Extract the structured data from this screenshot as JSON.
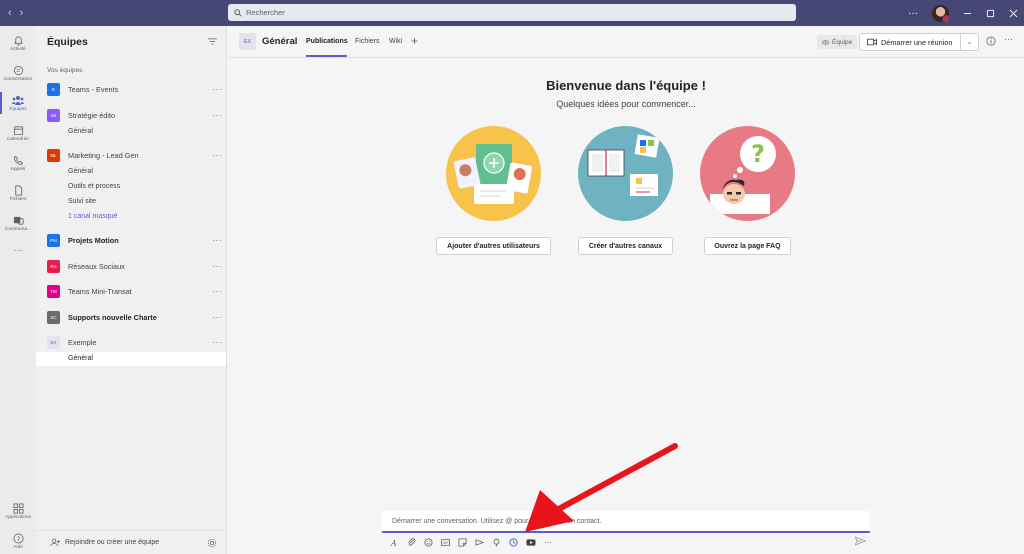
{
  "titlebar": {
    "search_placeholder": "Rechercher",
    "more": "···",
    "back_arrow": "‹",
    "forward_arrow": "›"
  },
  "rail": {
    "items": [
      {
        "label": "Activité",
        "icon": "bell-icon"
      },
      {
        "label": "Conversation",
        "icon": "chat-icon"
      },
      {
        "label": "Équipes",
        "icon": "teams-icon",
        "active": true
      },
      {
        "label": "Calendrier",
        "icon": "calendar-icon"
      },
      {
        "label": "Appels",
        "icon": "phone-icon"
      },
      {
        "label": "Fichiers",
        "icon": "file-icon"
      },
      {
        "label": "Communa...",
        "icon": "community-icon"
      }
    ],
    "more": "···",
    "bottom": [
      {
        "label": "Applications",
        "icon": "apps-icon"
      },
      {
        "label": "Aide",
        "icon": "help-icon"
      }
    ]
  },
  "panel": {
    "title": "Équipes",
    "section_label": "Vos équipes",
    "teams": [
      {
        "abbr": "E",
        "name": "Teams - Events",
        "color": "#1a73e8",
        "bold": false,
        "channels": []
      },
      {
        "abbr": "Sé",
        "name": "Stratégie édito",
        "color": "#8b5cf6",
        "bold": false,
        "channels": [
          "Général"
        ]
      },
      {
        "abbr": "ML",
        "name": "Marketing - Lead Gen",
        "color": "#d83b01",
        "bold": false,
        "channels": [
          "Général",
          "Outils et process",
          "Suivi site"
        ],
        "hidden_link": "1 canal masqué"
      },
      {
        "abbr": "PM",
        "name": "Projets Motion",
        "color": "#1a73e8",
        "bold": true,
        "channels": []
      },
      {
        "abbr": "RS",
        "name": "Réseaux Sociaux",
        "color": "#e81c4f",
        "bold": false,
        "channels": []
      },
      {
        "abbr": "TM",
        "name": "Teams Mini-Transat",
        "color": "#e3008c",
        "bold": false,
        "channels": []
      },
      {
        "abbr": "SC",
        "name": "Supports nouvelle Charte",
        "color": "#6b6b6b",
        "bold": true,
        "channels": []
      },
      {
        "abbr": "EX",
        "name": "Exemple",
        "color": "#e3e3f0",
        "bold": false,
        "channels": [
          "Général"
        ]
      }
    ],
    "more": "···",
    "join_label": "Rejoindre ou créer une équipe"
  },
  "header": {
    "avatar": "EX",
    "title": "Général",
    "tabs": [
      "Publications",
      "Fichiers",
      "Wiki"
    ],
    "plus": "+",
    "team_badge": "Équipe",
    "meet_label": "Démarrer une réunion",
    "chevron": "⌄",
    "more": "···"
  },
  "welcome": {
    "title": "Bienvenue dans l'équipe !",
    "subtitle": "Quelques idées pour commencer...",
    "actions": [
      "Ajouter d'autres utilisateurs",
      "Créer d'autres canaux",
      "Ouvrez la page FAQ"
    ]
  },
  "compose": {
    "placeholder": "Démarrer une conversation. Utilisez @ pour mentionner un contact."
  },
  "colors": {
    "accent": "#5b5fc7",
    "titlebar": "#464775",
    "annotation_arrow": "#e8141b"
  }
}
